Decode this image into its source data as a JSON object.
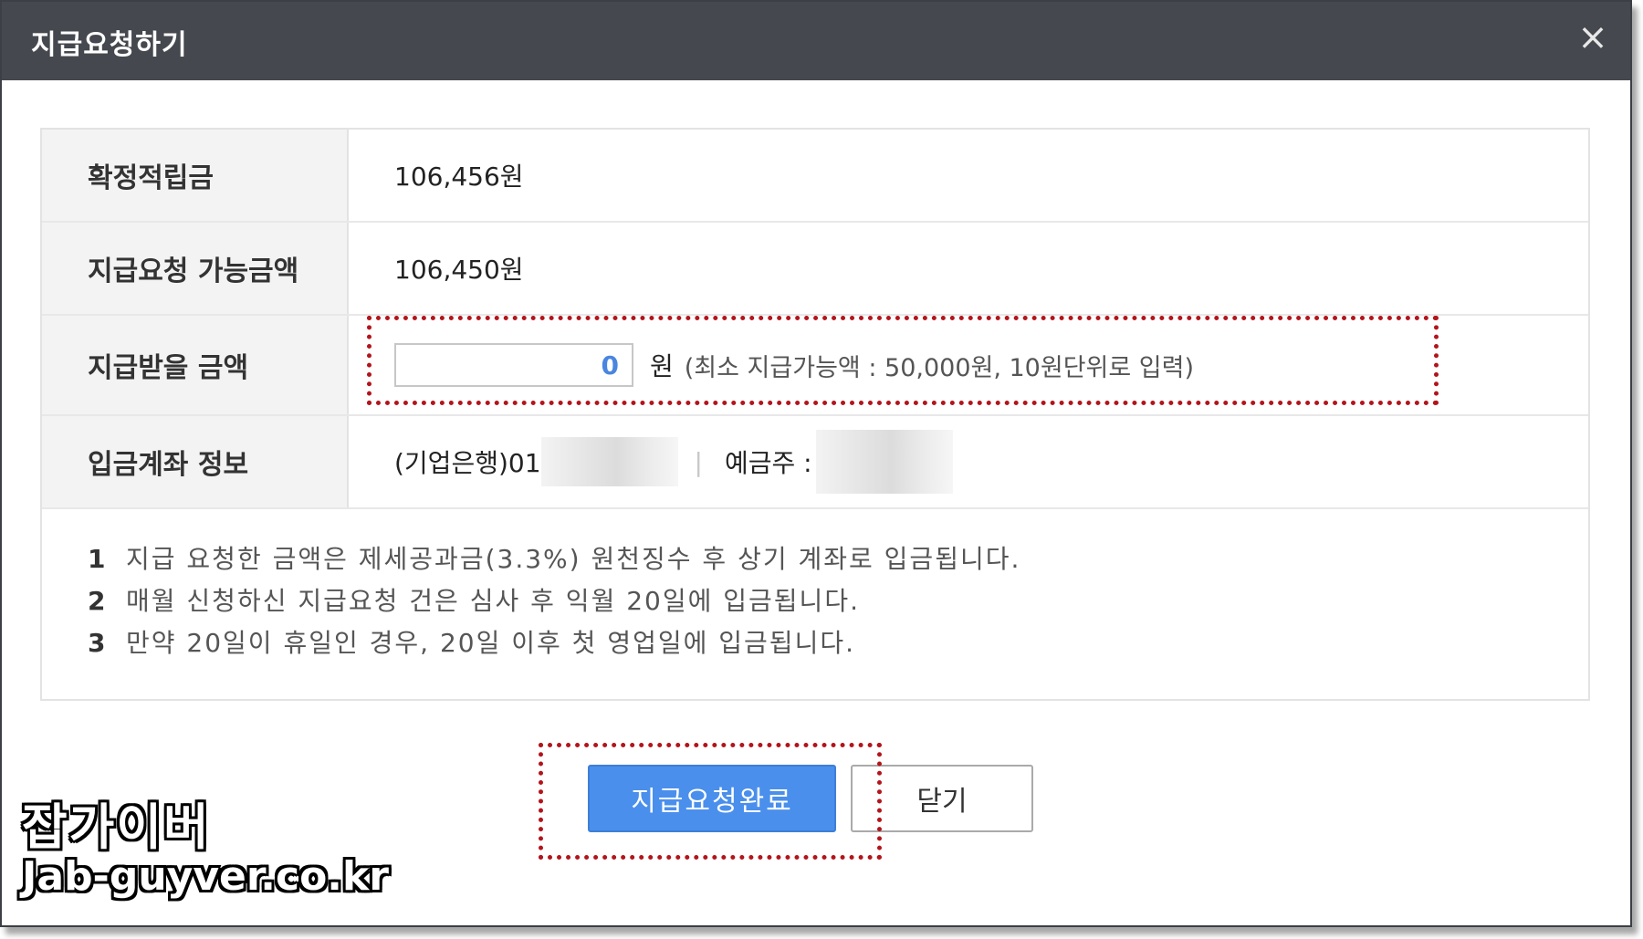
{
  "dialog": {
    "title": "지급요청하기",
    "close_label": "×"
  },
  "table": {
    "rows": [
      {
        "label": "확정적립금",
        "value": "106,456원"
      },
      {
        "label": "지급요청 가능금액",
        "value": "106,450원"
      },
      {
        "label": "지급받을 금액"
      },
      {
        "label": "입금계좌 정보"
      }
    ],
    "amount_input": {
      "value": "0",
      "unit": "원",
      "hint": "(최소 지급가능액 : 50,000원, 10원단위로 입력)"
    },
    "account": {
      "bank_prefix": "(기업은행)01",
      "separator": "|",
      "holder_label": "예금주 :"
    }
  },
  "notes": [
    {
      "num": "1",
      "text": "지급 요청한 금액은 제세공과금(3.3%) 원천징수 후 상기 계좌로 입금됩니다."
    },
    {
      "num": "2",
      "text": "매월 신청하신 지급요청 건은 심사 후 익월 20일에 입금됩니다."
    },
    {
      "num": "3",
      "text": "만약 20일이 휴일인 경우, 20일 이후 첫 영업일에 입금됩니다."
    }
  ],
  "buttons": {
    "submit_label": "지급요청완료",
    "close_label": "닫기"
  },
  "watermark": {
    "line1": "잡가이버",
    "line2": "Jab-guyver.co.kr"
  },
  "colors": {
    "titlebar": "#45484e",
    "primary": "#4a8fec",
    "highlight": "#b3141b"
  }
}
